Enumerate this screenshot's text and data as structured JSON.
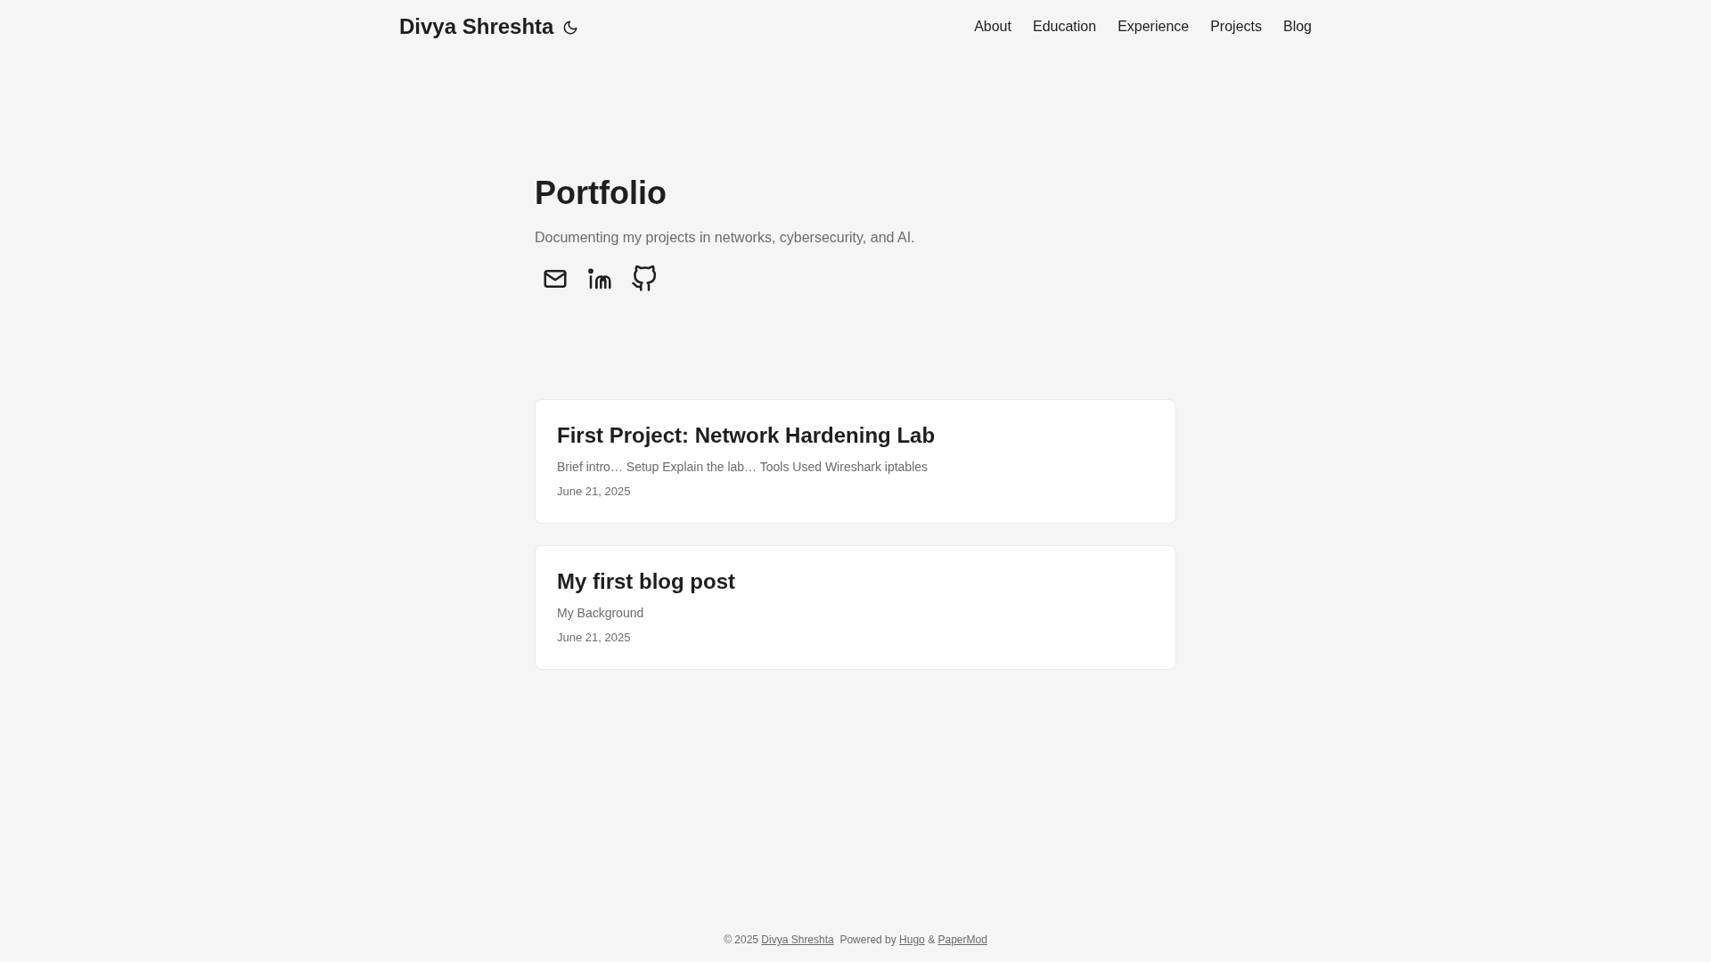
{
  "header": {
    "site_title": "Divya Shreshta",
    "nav": [
      {
        "label": "About"
      },
      {
        "label": "Education"
      },
      {
        "label": "Experience"
      },
      {
        "label": "Projects"
      },
      {
        "label": "Blog"
      }
    ]
  },
  "home_info": {
    "title": "Portfolio",
    "subtitle": "Documenting my projects in networks, cybersecurity, and AI.",
    "social": [
      {
        "kind": "email"
      },
      {
        "kind": "linkedin"
      },
      {
        "kind": "github"
      }
    ]
  },
  "posts": [
    {
      "title": "First Project: Network Hardening Lab",
      "summary": "Brief intro… Setup Explain the lab… Tools Used Wireshark iptables",
      "date": "June 21, 2025"
    },
    {
      "title": "My first blog post",
      "summary": "My Background",
      "date": "June 21, 2025"
    }
  ],
  "footer": {
    "copyright": "© 2025",
    "author_link": "Divya Shreshta",
    "powered_by": "Powered by",
    "hugo_link": "Hugo",
    "amp": "&",
    "theme_link": "PaperMod"
  }
}
